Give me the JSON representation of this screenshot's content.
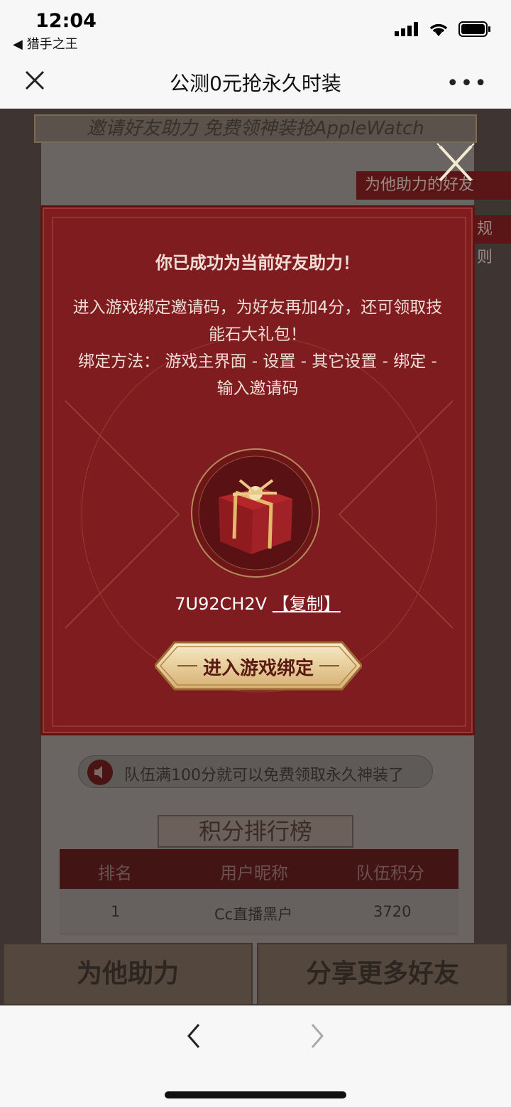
{
  "status_bar": {
    "time": "12:04",
    "back_app": "◀ 猎手之王",
    "icons": [
      "signal-icon",
      "wifi-icon",
      "battery-icon"
    ]
  },
  "navbar": {
    "title": "公测0元抢永久时装",
    "icons": [
      "close-icon",
      "more-icon"
    ]
  },
  "background_page": {
    "banner": "邀请好友助力 免费领神装抢AppleWatch",
    "side_tab_friends": "为他助力的好友",
    "side_tab_rules": "规则",
    "notice": "队伍满100分就可以免费领取永久神装了",
    "ranking_title": "积分排行榜",
    "ranking_headers": [
      "排名",
      "用户昵称",
      "队伍积分"
    ],
    "ranking_rows": [
      {
        "rank": "1",
        "name": "Cc直播黑户",
        "score": "3720"
      }
    ],
    "help_button": "为他助力",
    "share_button": "分享更多好友"
  },
  "modal": {
    "heading": "你已成功为当前好友助力！",
    "body_line1": "进入游戏绑定邀请码，为好友再加4分，还可领取技能石大礼包！",
    "body_line2": "绑定方法： 游戏主界面 - 设置 - 其它设置 - 绑定 - 输入邀请码",
    "code": "7U92CH2V",
    "copy_label": "【复制】",
    "enter_button": "进入游戏绑定",
    "colors": {
      "panel": "#7e1c1f",
      "button_gold": "#e6c98e"
    }
  },
  "toolbar": {
    "icons": [
      "back-arrow-icon",
      "forward-arrow-icon"
    ]
  }
}
